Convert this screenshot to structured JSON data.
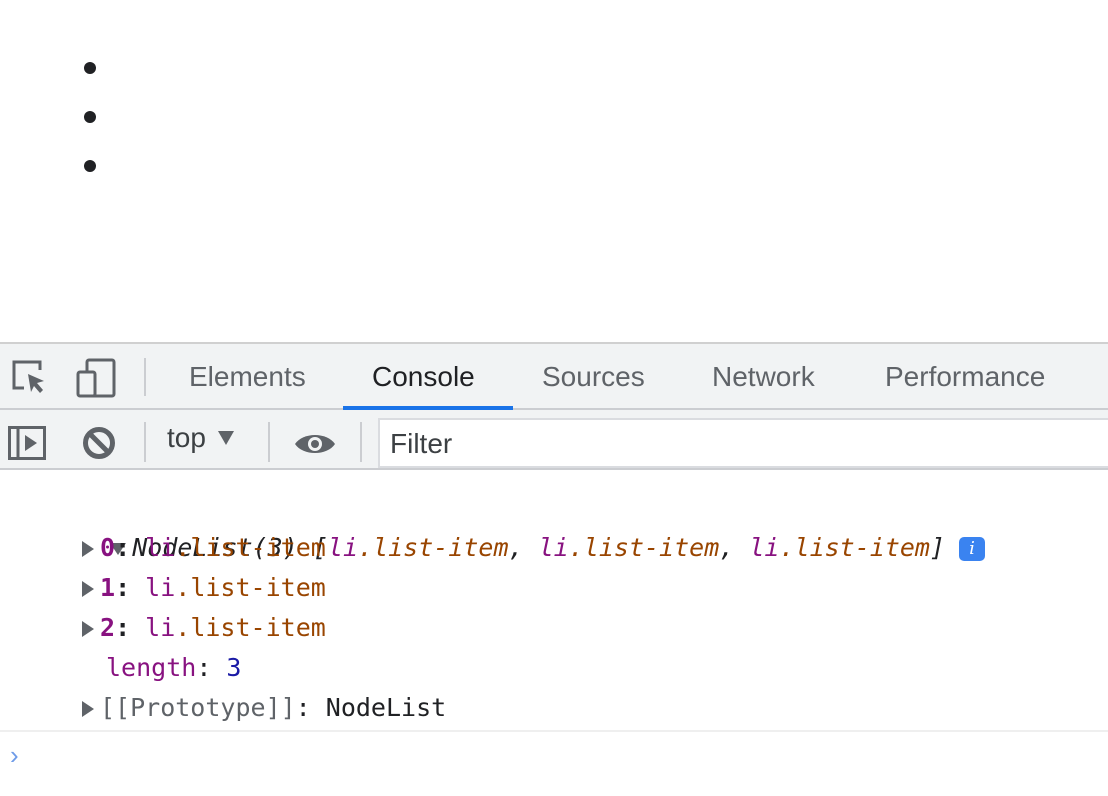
{
  "page": {
    "list_items": 3
  },
  "devtools": {
    "tabs": [
      {
        "label": "Elements"
      },
      {
        "label": "Console",
        "active": true
      },
      {
        "label": "Sources"
      },
      {
        "label": "Network"
      },
      {
        "label": "Performance"
      }
    ],
    "toolbar": {
      "context": "top",
      "filter_placeholder": "Filter"
    },
    "console": {
      "header": {
        "prefix": "NodeList(3) [",
        "items": [
          [
            "li",
            ".list-item"
          ],
          [
            "li",
            ".list-item"
          ],
          [
            "li",
            ".list-item"
          ]
        ],
        "suffix": "]",
        "info": "i"
      },
      "entries": [
        {
          "key": "0",
          "tag": "li",
          "cls": ".list-item"
        },
        {
          "key": "1",
          "tag": "li",
          "cls": ".list-item"
        },
        {
          "key": "2",
          "tag": "li",
          "cls": ".list-item"
        }
      ],
      "length_key": "length",
      "length_value": "3",
      "proto_key": "[[Prototype]]",
      "proto_value": "NodeList",
      "prompt": "›"
    },
    "colors": {
      "accent": "#1a73e8",
      "tag": "#881280",
      "class": "#994500",
      "number": "#1a1aa6"
    }
  }
}
